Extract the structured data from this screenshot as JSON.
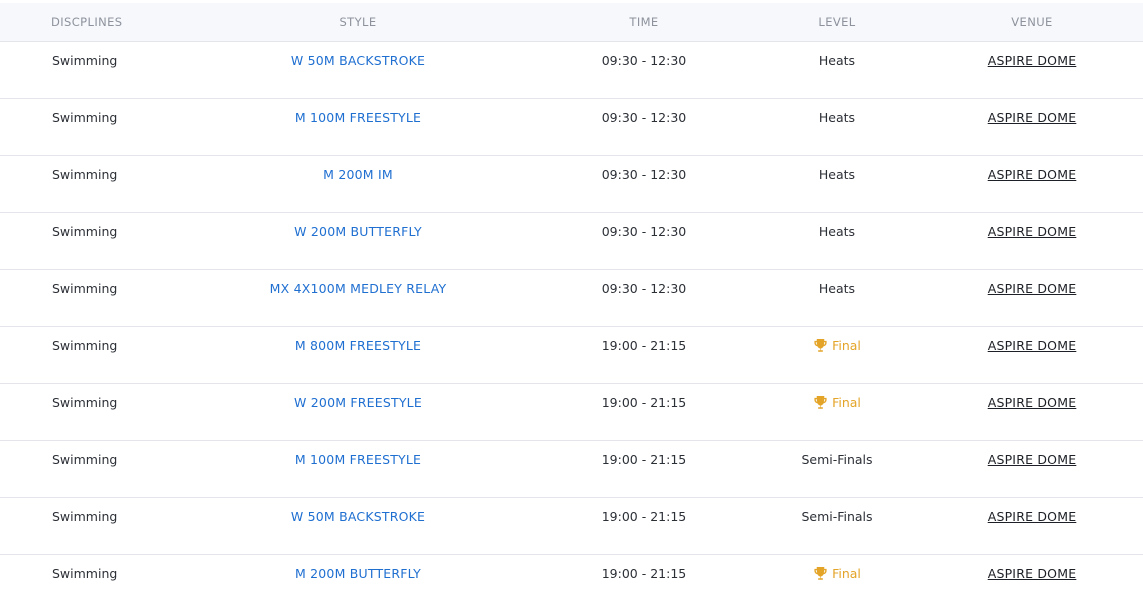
{
  "headers": {
    "disciplines": "DISCPLINES",
    "style": "STYLE",
    "time": "TIME",
    "level": "LEVEL",
    "venue": "VENUE"
  },
  "colors": {
    "style_link": "#1f6fd1",
    "final_accent": "#e3a428",
    "header_bg": "#f7f8fc"
  },
  "rows": [
    {
      "discipline": "Swimming",
      "style": "W 50M BACKSTROKE",
      "time": "09:30 - 12:30",
      "level": "Heats",
      "final": false,
      "venue": "ASPIRE DOME"
    },
    {
      "discipline": "Swimming",
      "style": "M 100M FREESTYLE",
      "time": "09:30 - 12:30",
      "level": "Heats",
      "final": false,
      "venue": "ASPIRE DOME"
    },
    {
      "discipline": "Swimming",
      "style": "M 200M IM",
      "time": "09:30 - 12:30",
      "level": "Heats",
      "final": false,
      "venue": "ASPIRE DOME"
    },
    {
      "discipline": "Swimming",
      "style": "W 200M BUTTERFLY",
      "time": "09:30 - 12:30",
      "level": "Heats",
      "final": false,
      "venue": "ASPIRE DOME"
    },
    {
      "discipline": "Swimming",
      "style": "MX 4X100M MEDLEY RELAY",
      "time": "09:30 - 12:30",
      "level": "Heats",
      "final": false,
      "venue": "ASPIRE DOME"
    },
    {
      "discipline": "Swimming",
      "style": "M 800M FREESTYLE",
      "time": "19:00 - 21:15",
      "level": "Final",
      "final": true,
      "icon": "trophy-icon",
      "venue": "ASPIRE DOME"
    },
    {
      "discipline": "Swimming",
      "style": "W 200M FREESTYLE",
      "time": "19:00 - 21:15",
      "level": "Final",
      "final": true,
      "icon": "trophy-icon",
      "venue": "ASPIRE DOME"
    },
    {
      "discipline": "Swimming",
      "style": "M 100M FREESTYLE",
      "time": "19:00 - 21:15",
      "level": "Semi-Finals",
      "final": false,
      "venue": "ASPIRE DOME"
    },
    {
      "discipline": "Swimming",
      "style": "W 50M BACKSTROKE",
      "time": "19:00 - 21:15",
      "level": "Semi-Finals",
      "final": false,
      "venue": "ASPIRE DOME"
    },
    {
      "discipline": "Swimming",
      "style": "M 200M BUTTERFLY",
      "time": "19:00 - 21:15",
      "level": "Final",
      "final": true,
      "icon": "trophy-icon",
      "venue": "ASPIRE DOME"
    }
  ]
}
